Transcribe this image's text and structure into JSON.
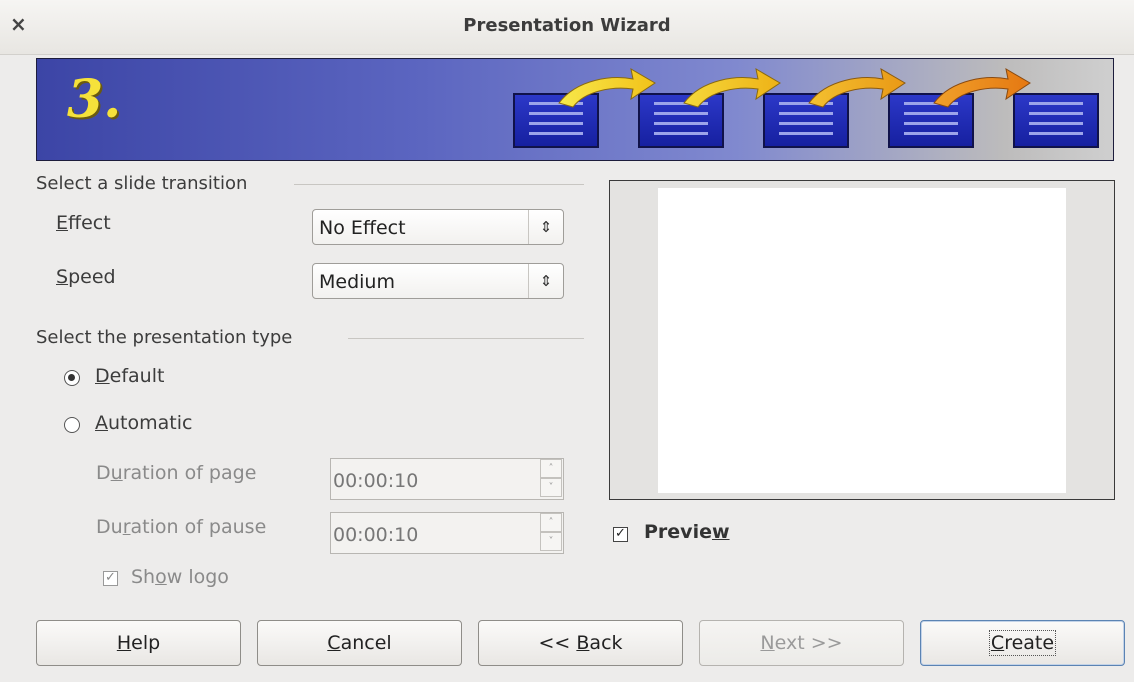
{
  "window": {
    "close_glyph": "×",
    "title": "Presentation Wizard"
  },
  "banner": {
    "step": "3."
  },
  "transition": {
    "section_title": "Select a slide transition",
    "effect_label_accel": "E",
    "effect_label_rest": "ffect",
    "effect_value": "No Effect",
    "speed_label_accel": "S",
    "speed_label_rest": "peed",
    "speed_value": "Medium",
    "combo_glyph": "⇕"
  },
  "type": {
    "section_title": "Select the presentation type",
    "default_accel": "D",
    "default_rest": "efault",
    "automatic_accel": "A",
    "automatic_rest": "utomatic",
    "selected": "Default",
    "page_label_pre": "D",
    "page_label_accel": "u",
    "page_label_rest": "ration of page",
    "page_value": "00:00:10",
    "pause_label_pre": "Du",
    "pause_label_accel": "r",
    "pause_label_rest": "ation of pause",
    "pause_value": "00:00:10",
    "show_logo_pre": "Sh",
    "show_logo_accel": "o",
    "show_logo_rest": "w logo",
    "show_logo_checked": true
  },
  "preview": {
    "label_pre": "Previe",
    "label_accel": "w",
    "checked": true
  },
  "check_glyph": "✓",
  "buttons": {
    "help_accel": "H",
    "help_rest": "elp",
    "cancel_accel": "C",
    "cancel_rest": "ancel",
    "back_pre": "<< ",
    "back_accel": "B",
    "back_rest": "ack",
    "next_accel": "N",
    "next_rest": "ext >>",
    "create_accel": "C",
    "create_rest": "reate"
  }
}
